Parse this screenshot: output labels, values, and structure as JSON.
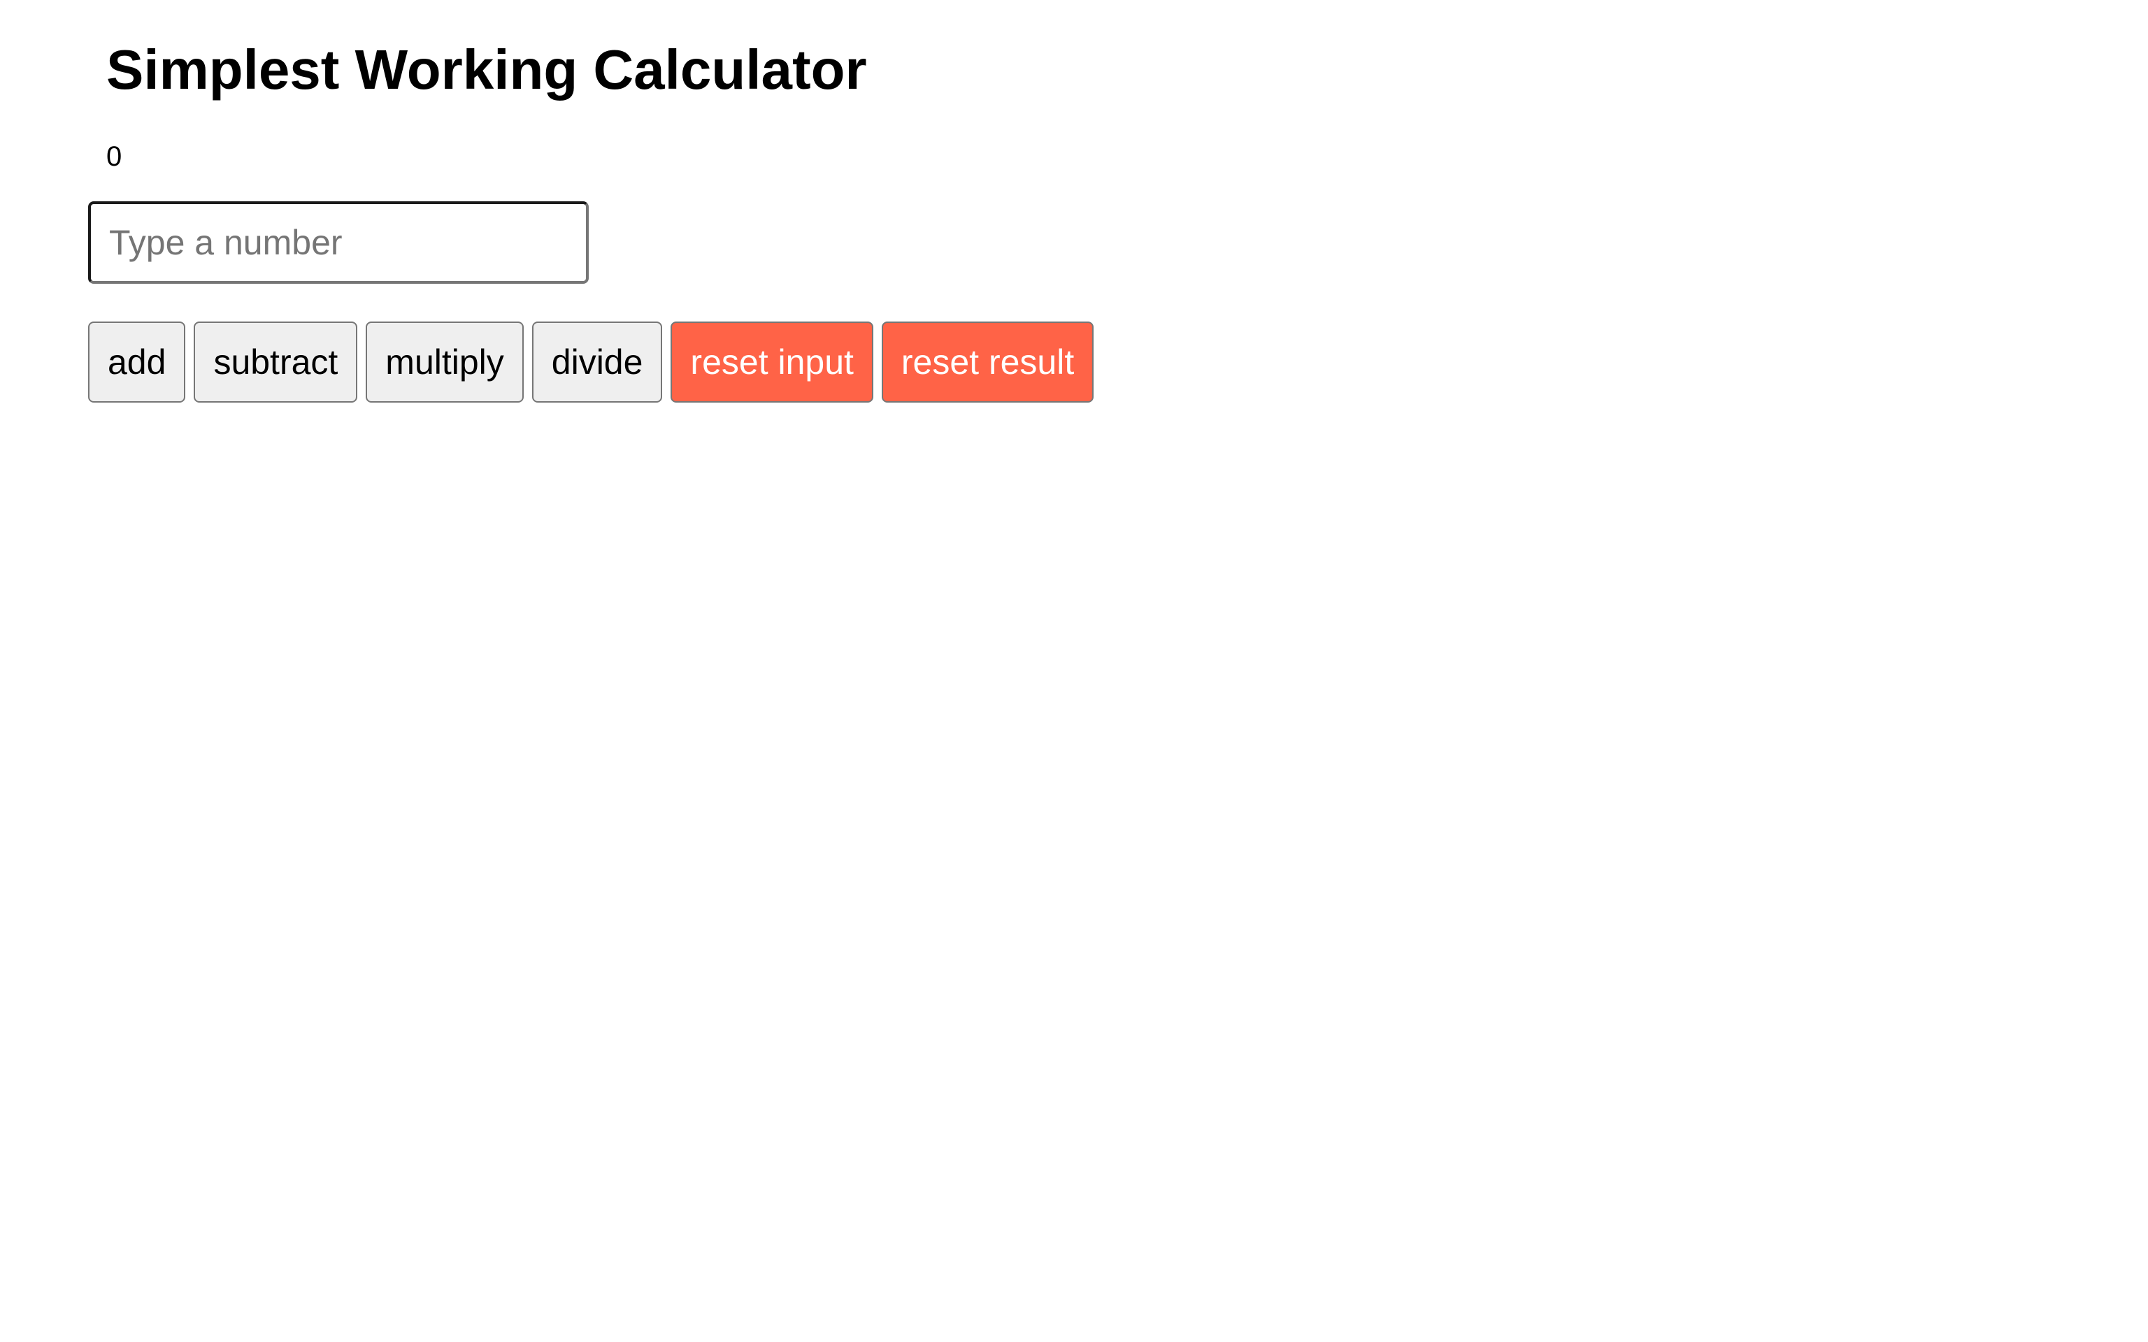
{
  "page": {
    "title": "Simplest Working Calculator",
    "result": "0"
  },
  "input": {
    "value": "",
    "placeholder": "Type a number"
  },
  "buttons": {
    "add": "add",
    "subtract": "subtract",
    "multiply": "multiply",
    "divide": "divide",
    "reset_input": "reset input",
    "reset_result": "reset result"
  },
  "colors": {
    "reset_button_bg": "#ff6347",
    "reset_button_text": "#ffffff",
    "default_button_bg": "#efefef"
  }
}
